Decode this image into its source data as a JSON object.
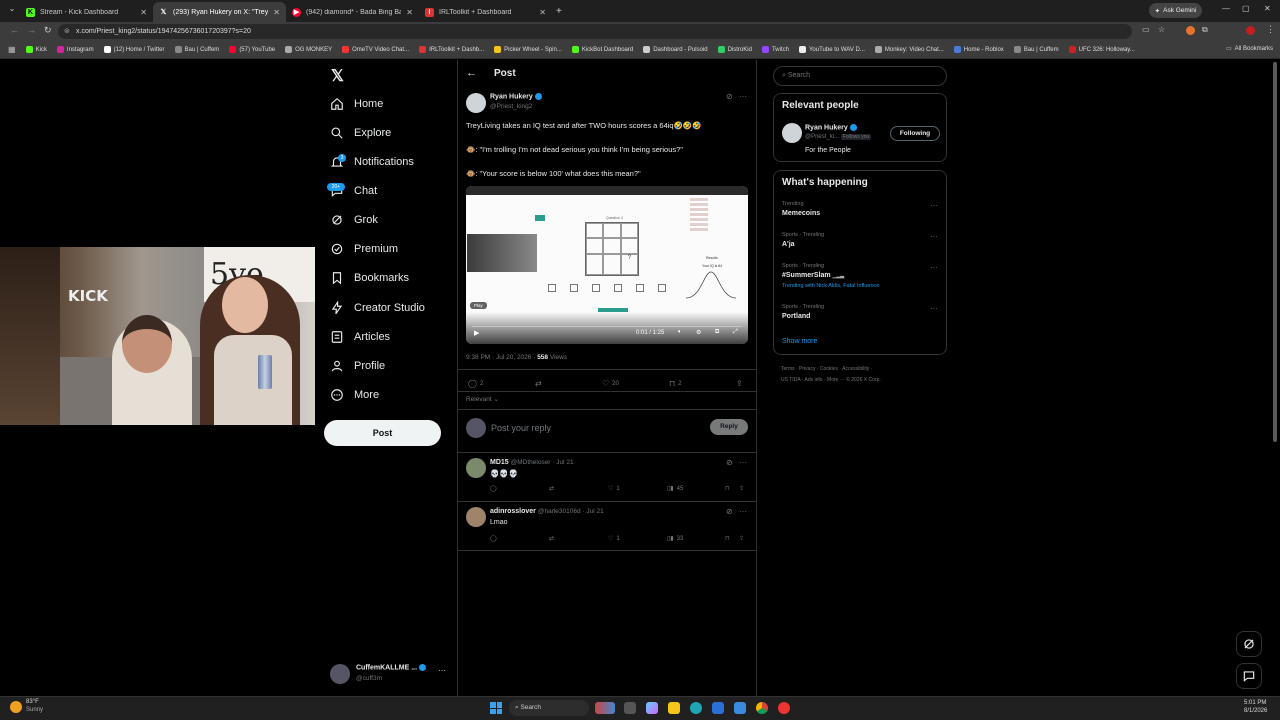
{
  "browser": {
    "tabs": [
      {
        "title": "Stream - Kick Dashboard",
        "favicon": "kick",
        "color": "#53fc18"
      },
      {
        "title": "(293) Ryan Hukery on X: \"TreyLi",
        "favicon": "x",
        "color": "#ffffff"
      },
      {
        "title": "(942) diamond* - Bada Bing Ba",
        "favicon": "youtube",
        "color": "#ff0033"
      },
      {
        "title": "IRLToolkit + Dashboard",
        "favicon": "irl",
        "color": "#d33"
      }
    ],
    "ask_gemini": "Ask Gemini",
    "url": "x.com/Priest_king2/status/1947425673601720397?s=20",
    "bookmarks": [
      "Kick",
      "Instagram",
      "(12) Home / Twitter",
      "Bau | Cuffem",
      "(57) YouTube",
      "OG MONKEY",
      "OmeTV Video Chat...",
      "IRLToolkit + Dashb...",
      "Picker Wheel - Spin...",
      "KickBot Dashboard",
      "Dashboard - Pulsoid",
      "DistroKid",
      "Twitch",
      "YouTube to WAV D...",
      "Monkey: Video Chat...",
      "Home - Roblox",
      "Bau | Cuffem",
      "UFC 326: Holloway..."
    ],
    "all_bookmarks": "All Bookmarks"
  },
  "nav": {
    "items": [
      "Home",
      "Explore",
      "Notifications",
      "Chat",
      "Grok",
      "Premium",
      "Bookmarks",
      "Creator Studio",
      "Articles",
      "Profile",
      "More"
    ],
    "notif_badge": "3",
    "chat_badge": "20+",
    "post_label": "Post",
    "account": {
      "name": "CuffemKALLME ...",
      "handle": "@cuff3m"
    }
  },
  "post": {
    "header": "Post",
    "author": "Ryan Hukery",
    "handle": "@Priest_king2",
    "line1": "TreyLiving takes an IQ test and after TWO hours scores a 64iq🤣🤣🤣",
    "line2": "🐵: \"I'm trolling I'm not dead serious you think I'm being serious?\"",
    "line3": "🐵: \"Your score is below 100' what does this mean?\"",
    "video": {
      "play_label": "Play",
      "time": "0:01 / 1:25",
      "results": "Results",
      "score": "Your IQ is 64",
      "test_title": "Question 3"
    },
    "timestamp": "9:38 PM · Jul 20, 2026 · ",
    "views_count": "558",
    "views_label": " Views",
    "replies": "2",
    "likes": "20",
    "bookmarks": "2",
    "sort": "Relevant",
    "reply_placeholder": "Post your reply",
    "reply_button": "Reply"
  },
  "replies": [
    {
      "name": "MD15",
      "handle": "@MDtheloser · Jul 21",
      "text": "💀💀💀",
      "likes": "1",
      "views": "45"
    },
    {
      "name": "adinrosslover",
      "handle": "@harle30106d · Jul 21",
      "text": "Lmao",
      "likes": "1",
      "views": "33"
    }
  ],
  "right": {
    "search_placeholder": "Search",
    "relevant_title": "Relevant people",
    "person": {
      "name": "Ryan Hukery",
      "handle": "@Priest_ki...",
      "follows_you": "Follows you",
      "bio": "For the People",
      "button": "Following"
    },
    "happening_title": "What's happening",
    "trends": [
      {
        "meta": "Trending",
        "name": "Memecoins",
        "extra": ""
      },
      {
        "meta": "Sports · Trending",
        "name": "A'ja",
        "extra": ""
      },
      {
        "meta": "Sports · Trending",
        "name": "#SummerSlam",
        "extra": "Trending with Nick Aldis, Fatal Influence"
      },
      {
        "meta": "Sports · Trending",
        "name": "Portland",
        "extra": ""
      }
    ],
    "show_more": "Show more",
    "footer1": "Terms · Privacy · Cookies · Accessibility ·",
    "footer2": "US TIDA · Ads info · More ··· © 2026 X Corp."
  },
  "webcam": {
    "sign_text": "KICK"
  },
  "taskbar": {
    "weather_temp": "83°F",
    "weather_desc": "Sunny",
    "search": "Search",
    "time": "5:01 PM",
    "date": "8/1/2026"
  }
}
